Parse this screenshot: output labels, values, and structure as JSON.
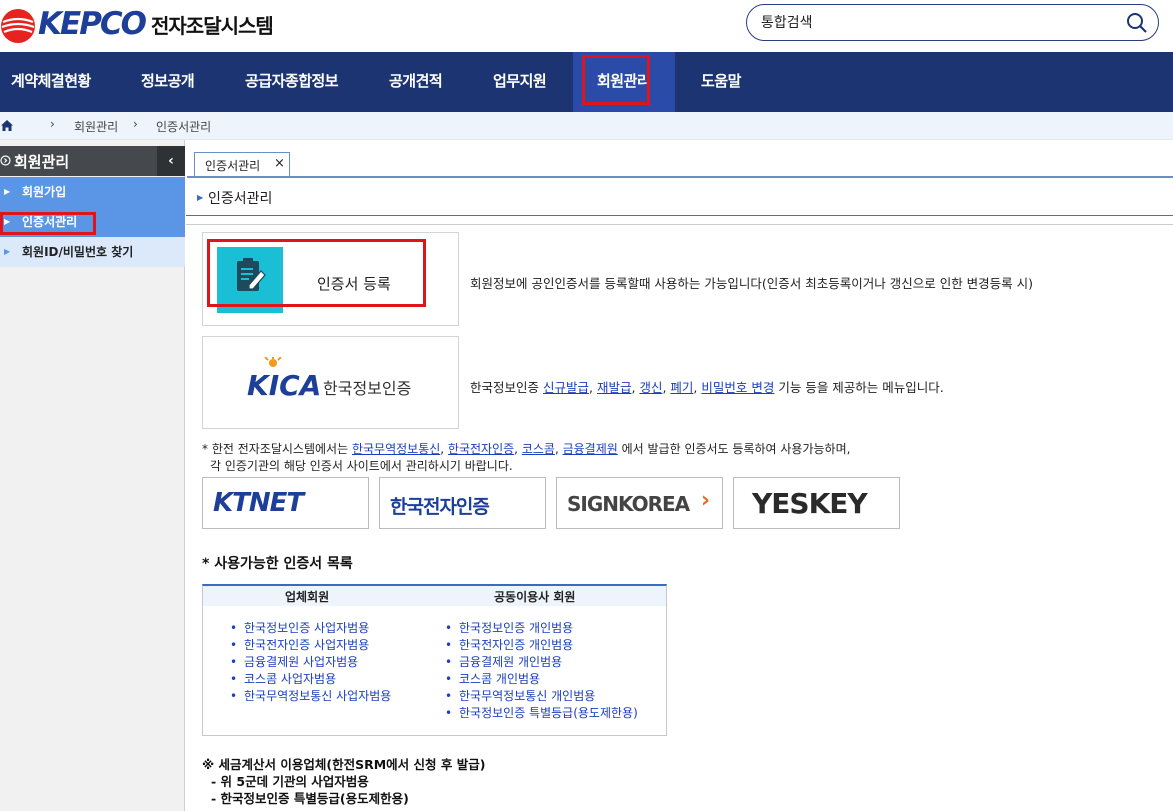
{
  "header": {
    "logo_text": "KEPCO",
    "system_title": "전자조달시스템",
    "search_placeholder": "통합검색"
  },
  "nav": {
    "items": [
      "계약체결현황",
      "정보공개",
      "공급자종합정보",
      "공개견적",
      "업무지원",
      "회원관리",
      "도움말"
    ],
    "active": "회원관리"
  },
  "breadcrumb": [
    "회원관리",
    "인증서관리"
  ],
  "sidebar": {
    "title": "회원관리",
    "collapse_icon": "‹",
    "items": [
      "회원가입",
      "인증서관리",
      "회원ID/비밀번호 찾기"
    ],
    "active": "인증서관리"
  },
  "tab": {
    "label": "인증서관리",
    "close": "×"
  },
  "content": {
    "title": "인증서관리",
    "register_button": "인증서 등록",
    "register_desc": "회원정보에 공인인증서를 등록할때 사용하는 가능입니다(인증서 최초등록이거나 갱신으로 인한 변경등록 시)",
    "kica_logo_text": "한국정보인증",
    "kica_desc_prefix": "한국정보인증",
    "kica_links": [
      "신규발급",
      "재발급",
      "갱신",
      "폐기",
      "비밀번호 변경"
    ],
    "kica_desc_suffix": "기능 등을 제공하는 메뉴입니다.",
    "notice_prefix": "* 한전 전자조달시스템에서는",
    "notice_links": [
      "한국무역정보통신",
      "한국전자인증",
      "코스콤",
      "금융결제원"
    ],
    "notice_suffix": "에서 발급한 인증서도 등록하여 사용가능하며,",
    "notice_line2": "각 인증기관의 해당 인증서 사이트에서 관리하시기 바랍니다.",
    "cert_logos": [
      "KTNET",
      "한국전자인증",
      "SIGNKOREA",
      "YESKEY"
    ],
    "list_title": "* 사용가능한 인증서 목록",
    "list_headers": [
      "업체회원",
      "공동이용사 회원"
    ],
    "company_certs": [
      "한국정보인증 사업자범용",
      "한국전자인증 사업자범용",
      "금융결제원 사업자범용",
      "코스콤 사업자범용",
      "한국무역정보통신 사업자범용"
    ],
    "joint_certs": [
      "한국정보인증 개인범용",
      "한국전자인증 개인범용",
      "금융결제원 개인범용",
      "코스콤 개인범용",
      "한국무역정보통신 개인범용",
      "한국정보인증 특별등급(용도제한용)"
    ],
    "tax_note_title": "※ 세금계산서 이용업체(한전SRM에서 신청 후 발급)",
    "tax_note_lines": [
      "- 위 5군데 기관의 사업자범용",
      "- 한국정보인증 특별등급(용도제한용)"
    ]
  },
  "colors": {
    "nav_bg": "#1c3572",
    "nav_active": "#2a4ba8",
    "highlight_red": "#e0141b",
    "sidebar_active": "#5a95e6",
    "link_blue": "#1a3fbf"
  }
}
